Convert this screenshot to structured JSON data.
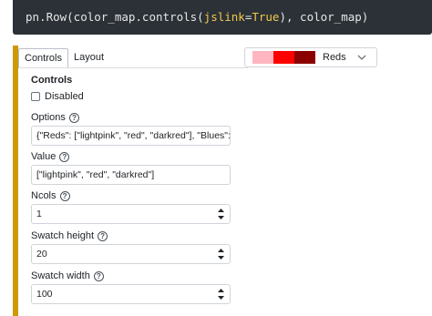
{
  "code": {
    "prefix": "pn.Row(color_map.controls(",
    "kw": "jslink",
    "eq": "=",
    "val": "True",
    "suffix": "), color_map)"
  },
  "tabs": [
    {
      "label": "Controls",
      "active": true
    },
    {
      "label": "Layout",
      "active": false
    }
  ],
  "color_select": {
    "selected": "Reds",
    "swatches": [
      "#ffb6c1",
      "#ff0000",
      "#8b0000"
    ]
  },
  "panel": {
    "title": "Controls",
    "disabled_label": "Disabled",
    "disabled_checked": false
  },
  "fields": [
    {
      "label": "Options",
      "value": "{\"Reds\": [\"lightpink\", \"red\", \"darkred\"], \"Blues\": [\"lightblue\"",
      "spinner": false
    },
    {
      "label": "Value",
      "value": "[\"lightpink\", \"red\", \"darkred\"]",
      "spinner": false
    },
    {
      "label": "Ncols",
      "value": "1",
      "spinner": true
    },
    {
      "label": "Swatch height",
      "value": "20",
      "spinner": true
    },
    {
      "label": "Swatch width",
      "value": "100",
      "spinner": true
    }
  ],
  "accent_color": "#cc9a06"
}
